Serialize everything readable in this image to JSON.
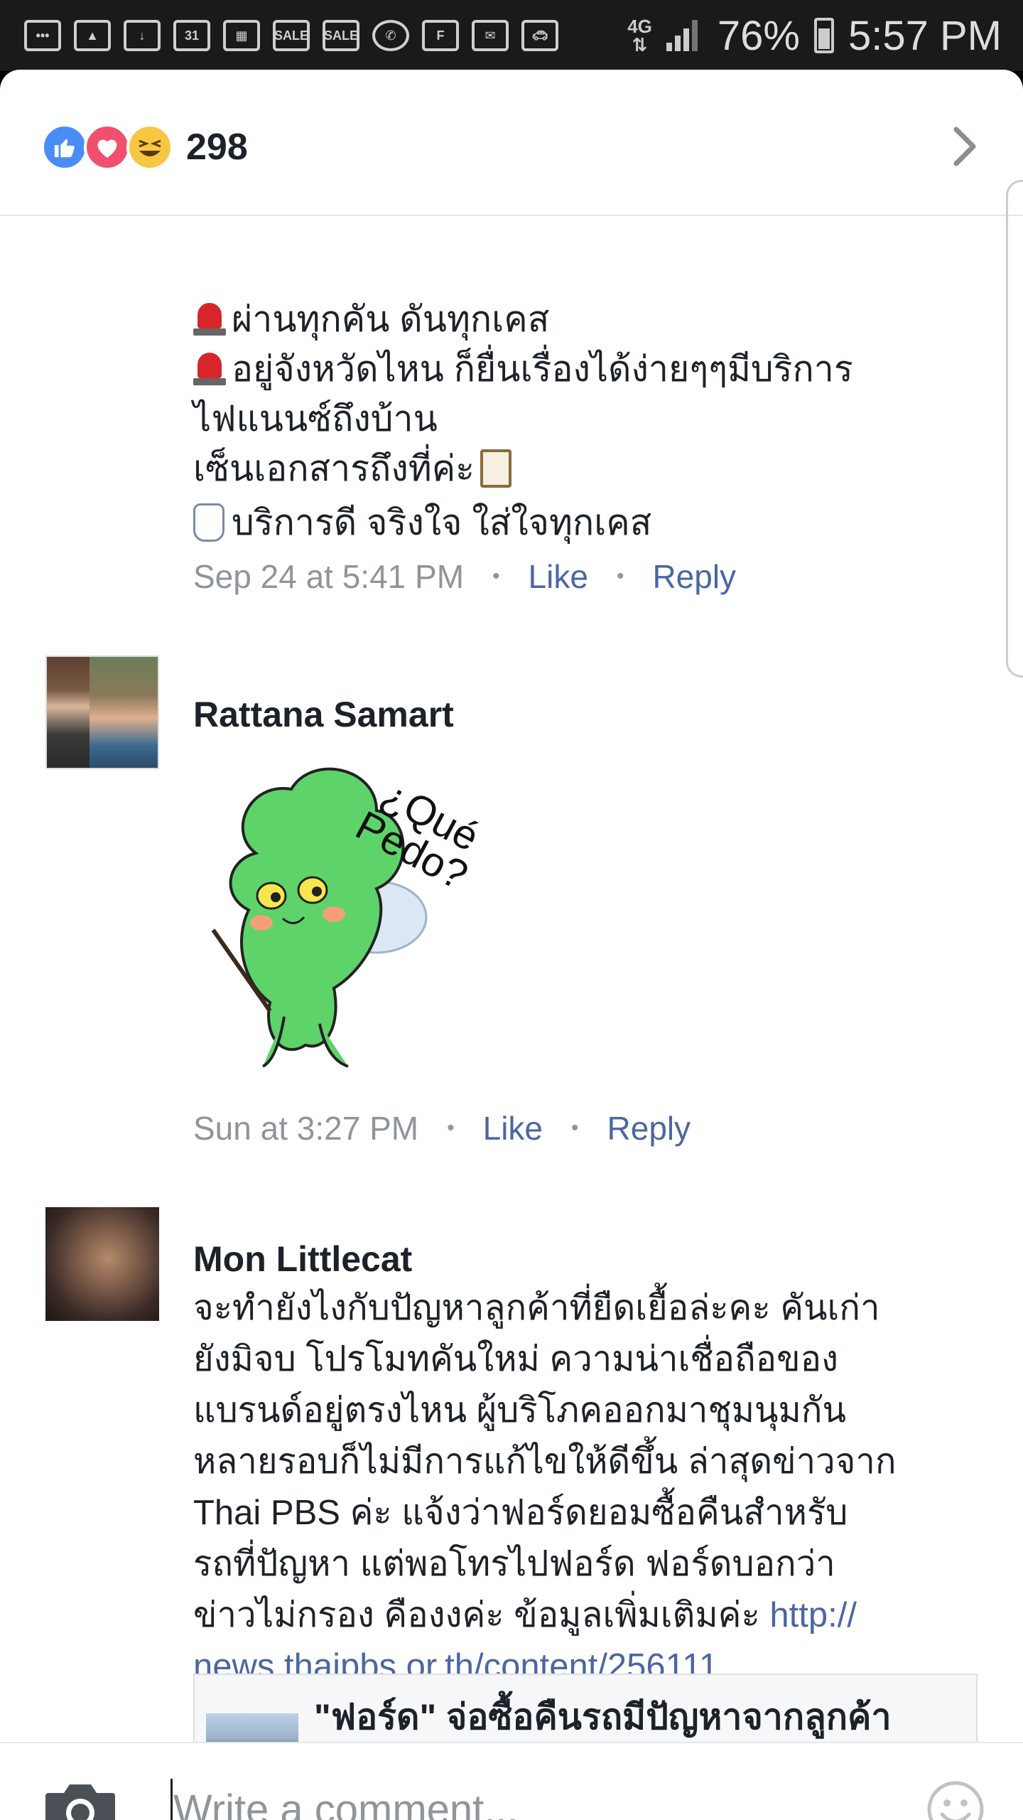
{
  "status_bar": {
    "network": "4G",
    "battery": "76%",
    "time": "5:57 PM",
    "notification_icons": [
      "messages-icon",
      "gallery-icon",
      "download-icon",
      "calendar-icon",
      "calendar-grid-icon",
      "sale-icon",
      "sale-icon",
      "whatsapp-icon",
      "flipboard-icon",
      "email-icon",
      "car-icon"
    ],
    "calendar_day": "31",
    "sale_label": "SALE"
  },
  "header": {
    "reaction_count": "298",
    "reactions": [
      "like",
      "love",
      "haha"
    ]
  },
  "comments": [
    {
      "lines": [
        "ผ่านทุกคัน  ดันทุกเคส",
        "อยู่จังหวัดไหน ก็ยื่นเรื่องได้ง่ายๆๆมีบริการ",
        "ไฟแนนซ์ถึงบ้าน",
        "เซ็นเอกสารถึงที่ค่ะ",
        "บริการดี จริงใจ ใส่ใจทุกเคส"
      ],
      "time": "Sep 24 at 5:41 PM",
      "like": "Like",
      "reply": "Reply"
    },
    {
      "author": "Rattana Samart",
      "sticker_text": "¿Qué Pedo?",
      "time": "Sun at 3:27 PM",
      "like": "Like",
      "reply": "Reply"
    },
    {
      "author": "Mon Littlecat",
      "lines": [
        "จะทำยังไงกับปัญหาลูกค้าที่ยืดเยื้อล่ะคะ คันเก่า",
        "ยังมิจบ โปรโมทคันใหม่ ความน่าเชื่อถือของ",
        "แบรนด์อยู่ตรงไหน ผู้บริโภคออกมาชุมนุมกัน",
        "หลายรอบก็ไม่มีการแก้ไขให้ดีขึ้น ล่าสุดข่าวจาก",
        "Thai PBS  ค่ะ แจ้งว่าฟอร์ดยอมซื้อคืนสำหรับ",
        "รถที่ปัญหา แต่พอโทรไปฟอร์ด  ฟอร์ดบอกว่า",
        "ข่าวไม่กรอง คืองงค่ะ ข้อมูลเพิ่มเติมค่ะ "
      ],
      "link_part1": "http://",
      "link_part2": "news.thaipbs.or.th/content/256111",
      "preview_title": "\"ฟอร์ด\" จ่อซื้อคืนรถมีปัญหาจากลูกค้า"
    }
  ],
  "composer": {
    "placeholder": "Write a comment..."
  },
  "colors": {
    "link": "#4b67a1",
    "meta": "#90949c",
    "text": "#1d2129",
    "like_blue": "#4a8df6",
    "love_red": "#f0506e",
    "haha_yellow": "#f7c744"
  }
}
